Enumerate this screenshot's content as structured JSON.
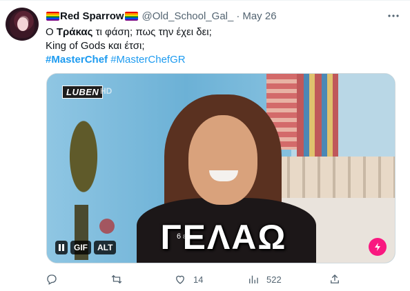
{
  "tweet": {
    "display_name": "Red Sparrow",
    "handle": "@Old_School_Gal_",
    "separator": "·",
    "date": "May 26",
    "text_line1_pre": "Ο ",
    "text_line1_bold": "Τράκας",
    "text_line1_post": " τι φάση; πως την έχει δει;",
    "text_line2": "King of Gods και έτσι;",
    "hashtag1": "#MasterChef",
    "hashtag2": "#MasterChefGR"
  },
  "media": {
    "channel_logo": "LUBEN",
    "channel_hd": "HD",
    "caption": "ΓΕΛΑΩ",
    "small_text": "6 ετ",
    "gif_label": "GIF",
    "alt_label": "ALT"
  },
  "actions": {
    "reply_count": "",
    "retweet_count": "",
    "like_count": "14",
    "views_count": "522"
  },
  "colors": {
    "accent": "#1d9bf0",
    "secondary_text": "#536471",
    "bolt_badge": "#f91880"
  },
  "icons": [
    "more-icon",
    "reply-icon",
    "retweet-icon",
    "like-icon",
    "views-icon",
    "share-icon",
    "pause-icon",
    "bolt-icon",
    "rainbow-flag-icon"
  ]
}
